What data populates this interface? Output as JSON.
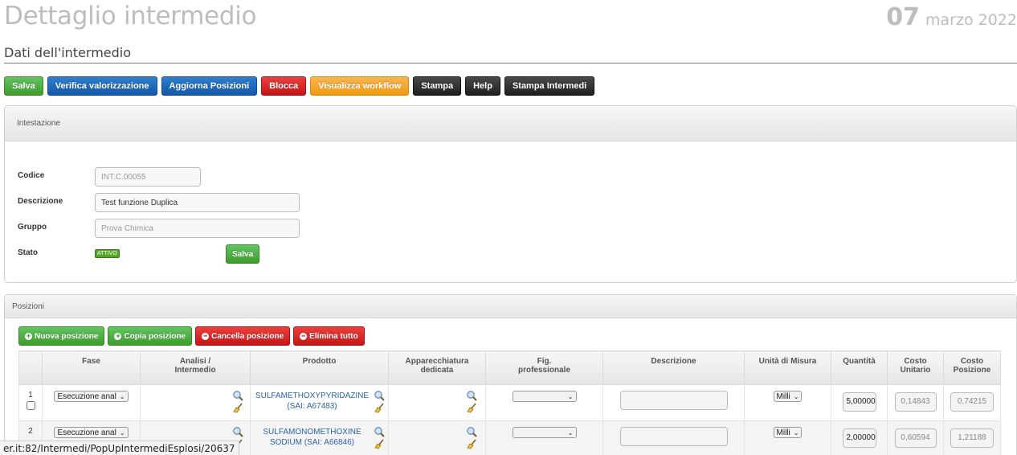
{
  "header": {
    "title": "Dettaglio intermedio",
    "day": "07",
    "month_year": "marzo 2022",
    "subtitle": "Dati dell'intermedio"
  },
  "toolbar": {
    "salva": "Salva",
    "verifica": "Verifica valorizzazione",
    "aggiorna": "Aggiorna Posizioni",
    "blocca": "Blocca",
    "workflow": "Visualizza workflow",
    "stampa": "Stampa",
    "help": "Help",
    "stampa_intermedi": "Stampa Intermedi"
  },
  "intestazione": {
    "title": "Intestazione",
    "codice_label": "Codice",
    "codice_value": "INT.C.00055",
    "descrizione_label": "Descrizione",
    "descrizione_value": "Test funzione Duplica",
    "gruppo_label": "Gruppo",
    "gruppo_value": "Prova Chimica",
    "stato_label": "Stato",
    "stato_value": "ATTIVO",
    "salva": "Salva"
  },
  "posizioni": {
    "title": "Posizioni",
    "nuova": "Nuova posizione",
    "copia": "Copia posizione",
    "cancella": "Cancella posizione",
    "elimina": "Elimina tutto",
    "columns": {
      "fase": "Fase",
      "analisi_1": "Analisi /",
      "analisi_2": "Intermedio",
      "prodotto": "Prodotto",
      "app_1": "Apparecchiatura",
      "app_2": "dedicata",
      "fig_1": "Fig.",
      "fig_2": "professionale",
      "descrizione": "Descrizione",
      "unita": "Unità di Misura",
      "quantita": "Quantità",
      "cu_1": "Costo",
      "cu_2": "Unitario",
      "cp_1": "Costo",
      "cp_2": "Posizione"
    },
    "rows": [
      {
        "num": "1",
        "fase": "Esecuzione anal",
        "prod_1": "SULFAMETHOXYPYRIDAZINE",
        "prod_2": "(SAI: A67483)",
        "unita": "Milli",
        "quantita": "5,00000",
        "costo_unitario": "0,14843",
        "costo_posizione": "0,74215"
      },
      {
        "num": "2",
        "fase": "Esecuzione anal",
        "prod_1": "SULFAMONOMETHOXINE",
        "prod_2": "SODIUM (SAI: A66846)",
        "unita": "Milli",
        "quantita": "2,00000",
        "costo_unitario": "0,60594",
        "costo_posizione": "1,21188"
      }
    ]
  },
  "status_url": "er.it:82/Intermedi/PopUpIntermediEsplosi/20637"
}
